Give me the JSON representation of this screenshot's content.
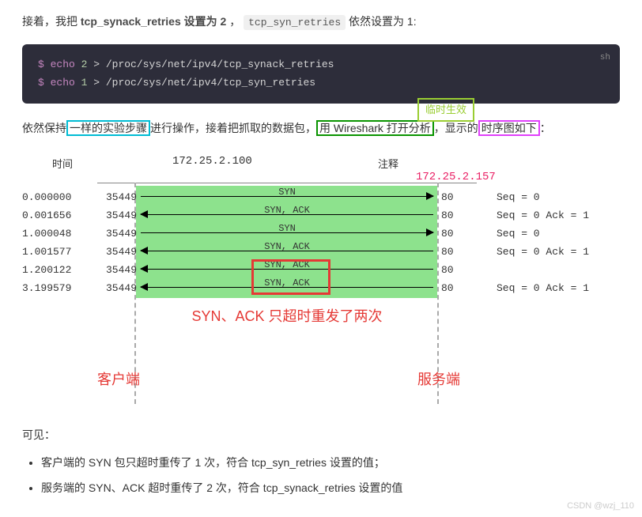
{
  "intro": {
    "prefix": "接着，我把 ",
    "bold": "tcp_synack_retries 设置为 2",
    "mid": " ，",
    "code": "tcp_syn_retries",
    "suffix": " 依然设置为 1:"
  },
  "code_block": {
    "lang": "sh",
    "line1_prompt": "$ ",
    "line1_cmd": "echo",
    "line1_num": " 2",
    "line1_rest": " >  /proc/sys/net/ipv4/tcp_synack_retries",
    "line2_prompt": "$ ",
    "line2_cmd": "echo",
    "line2_num": " 1",
    "line2_rest": " >  /proc/sys/net/ipv4/tcp_syn_retries",
    "annotation": "临时生效"
  },
  "para2": {
    "p1": "依然保持",
    "hl_cyan": "一样的实验步骤",
    "p2": "进行操作，接着把抓取的数据包，",
    "hl_green": "用 Wireshark 打开分析",
    "p3": "，显示的",
    "hl_magenta": "时序图如下",
    "p4": "："
  },
  "diagram": {
    "time_header": "时间",
    "annotation_header": "注释",
    "ip_left": "172.25.2.100",
    "ip_right": "172.25.2.157",
    "rows": [
      {
        "time": "0.000000",
        "port_l": "35449",
        "label": "SYN",
        "dir": "r",
        "port_r": "80",
        "seq": "Seq = 0"
      },
      {
        "time": "0.001656",
        "port_l": "35449",
        "label": "SYN, ACK",
        "dir": "l",
        "port_r": "80",
        "seq": "Seq = 0 Ack = 1"
      },
      {
        "time": "1.000048",
        "port_l": "35449",
        "label": "SYN",
        "dir": "r",
        "port_r": "80",
        "seq": "Seq = 0"
      },
      {
        "time": "1.001577",
        "port_l": "35449",
        "label": "SYN, ACK",
        "dir": "l",
        "port_r": "80",
        "seq": "Seq = 0 Ack = 1"
      },
      {
        "time": "1.200122",
        "port_l": "35449",
        "label": "SYN, ACK",
        "dir": "l",
        "port_r": "80",
        "seq": ""
      },
      {
        "time": "3.199579",
        "port_l": "35449",
        "label": "SYN, ACK",
        "dir": "l",
        "port_r": "80",
        "seq": "Seq = 0 Ack = 1"
      }
    ],
    "red_caption": "SYN、ACK 只超时重发了两次",
    "client_label": "客户端",
    "server_label": "服务端"
  },
  "section_head": "可见：",
  "bullets": [
    "客户端的 SYN 包只超时重传了 1 次，符合 tcp_syn_retries 设置的值；",
    "服务端的 SYN、ACK 超时重传了 2 次，符合 tcp_synack_retries 设置的值"
  ],
  "watermark": "CSDN @wzj_110"
}
